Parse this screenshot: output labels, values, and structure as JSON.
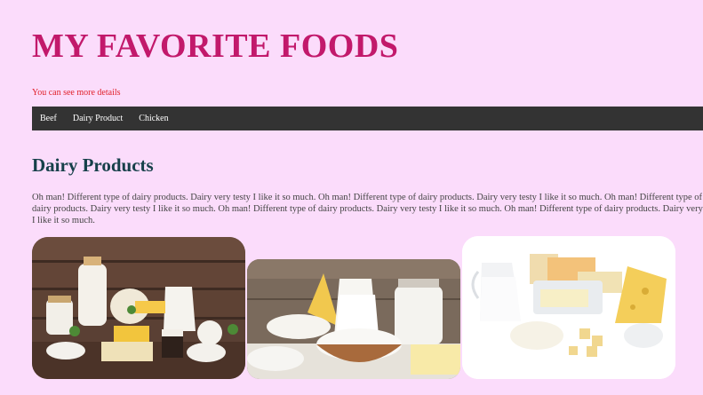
{
  "header": {
    "title": "MY FAVORITE FOODS",
    "subtitle": "You can see more details"
  },
  "nav": {
    "items": [
      {
        "label": "Beef"
      },
      {
        "label": "Dairy Product"
      },
      {
        "label": "Chicken"
      }
    ]
  },
  "section": {
    "title": "Dairy Products",
    "lines": [
      "Oh man! Different type of dairy products. Dairy very testy I like it so much. Oh man! Different type of dairy products. Dairy very testy I like it so much. Oh man! Different type of",
      "dairy products. Dairy very testy I like it so much. Oh man! Different type of dairy products. Dairy very testy I like it so much. Oh man! Different type of dairy products. Dairy very testy",
      "I like it so much."
    ]
  },
  "colors": {
    "page_bg": "#fbdcfb",
    "title": "#c2196b",
    "subtitle": "#e0202a",
    "nav_bg": "#333333",
    "section_title": "#17404a"
  }
}
